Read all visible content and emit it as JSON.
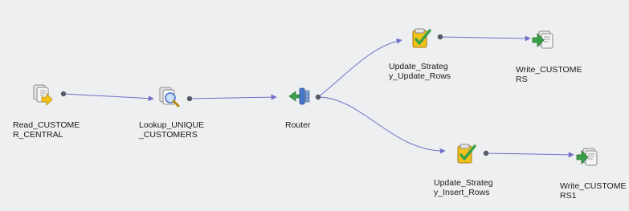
{
  "mapping": {
    "nodes": [
      {
        "id": "read",
        "label_line1": "Read_CUSTOME",
        "label_line2": "R_CENTRAL",
        "icon": "source-qualifier-icon"
      },
      {
        "id": "lookup",
        "label_line1": "Lookup_UNIQUE",
        "label_line2": "_CUSTOMERS",
        "icon": "lookup-icon"
      },
      {
        "id": "router",
        "label_line1": "Router",
        "label_line2": "",
        "icon": "router-icon"
      },
      {
        "id": "upd",
        "label_line1": "Update_Strateg",
        "label_line2": "y_Update_Rows",
        "icon": "update-strategy-icon"
      },
      {
        "id": "ins",
        "label_line1": "Update_Strateg",
        "label_line2": "y_Insert_Rows",
        "icon": "update-strategy-icon"
      },
      {
        "id": "w1",
        "label_line1": "Write_CUSTOME",
        "label_line2": "RS",
        "icon": "target-write-icon"
      },
      {
        "id": "w2",
        "label_line1": "Write_CUSTOME",
        "label_line2": "RS1",
        "icon": "target-write-icon"
      }
    ],
    "links": [
      {
        "from": "read",
        "to": "lookup"
      },
      {
        "from": "lookup",
        "to": "router"
      },
      {
        "from": "router",
        "to": "upd"
      },
      {
        "from": "router",
        "to": "ins"
      },
      {
        "from": "upd",
        "to": "w1"
      },
      {
        "from": "ins",
        "to": "w2"
      }
    ],
    "colors": {
      "background": "#eeeff0",
      "link": "#6f6fc8",
      "port": "#555a66",
      "icon_yellow": "#f2c21b",
      "icon_green": "#3aa04a",
      "icon_blue": "#4a78c8"
    }
  }
}
